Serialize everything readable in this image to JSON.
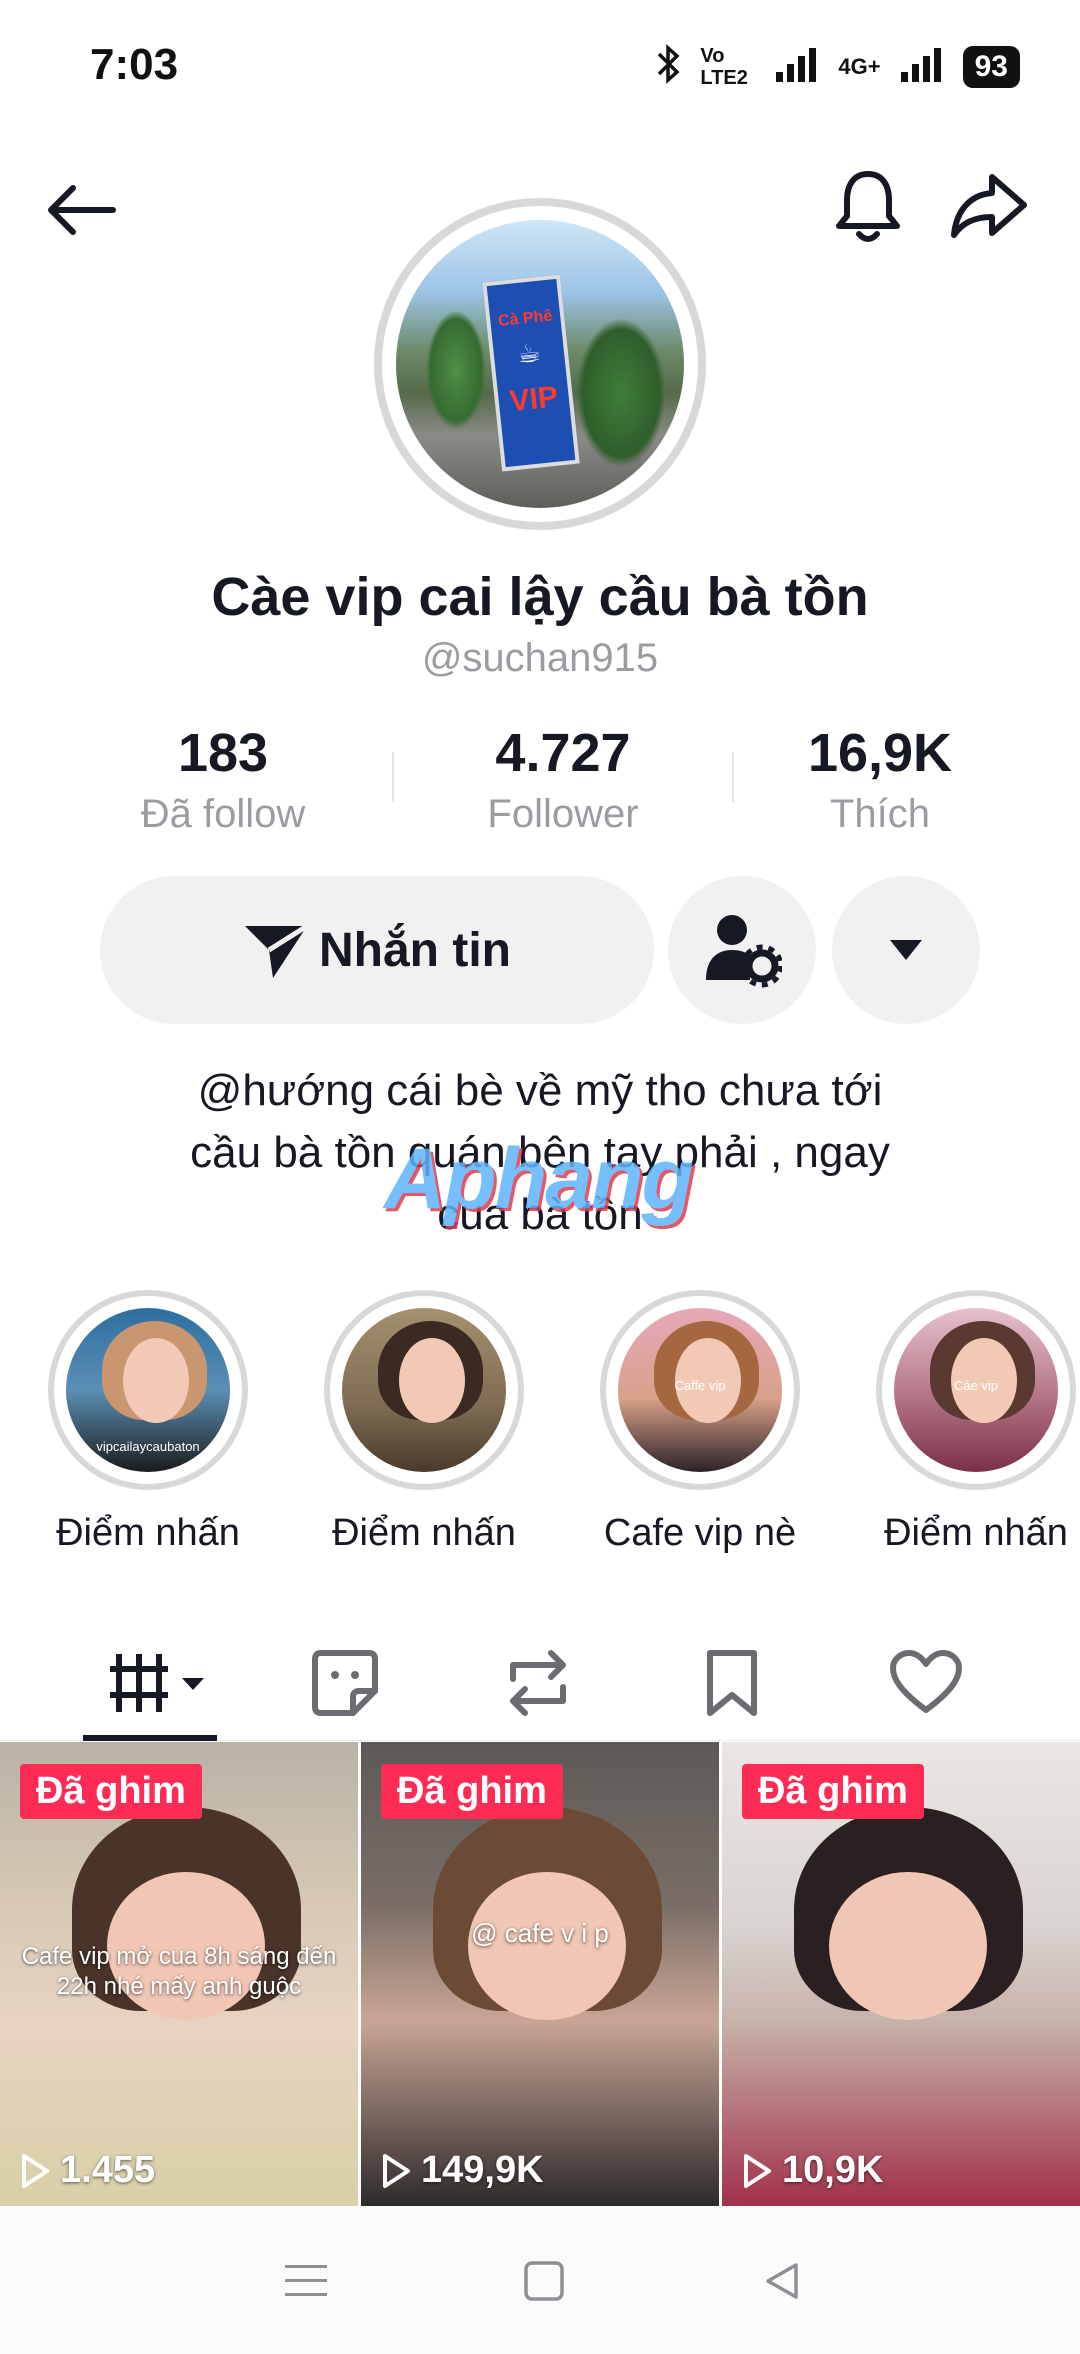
{
  "status_bar": {
    "time": "7:03",
    "network_1": "Vo LTE2",
    "network_2": "4G+",
    "battery": "93"
  },
  "profile": {
    "display_name": "Càe vip cai lậy cầu bà tồn",
    "username": "@suchan915",
    "stats": [
      {
        "value": "183",
        "label": "Đã follow"
      },
      {
        "value": "4.727",
        "label": "Follower"
      },
      {
        "value": "16,9K",
        "label": "Thích"
      }
    ],
    "message_button": "Nhắn tin",
    "bio_lines": [
      "@hướng cái bè về mỹ tho chưa tới",
      "cầu bà tồn quán bên tay phải , ngay",
      "cua bà tồn"
    ],
    "watermark": "Aphang",
    "avatar_sign": {
      "line1": "Cà Phê",
      "line2": "VIP"
    }
  },
  "highlights": [
    {
      "label": "Điểm nhấn",
      "overlay": "vipcailaycaubaton"
    },
    {
      "label": "Điểm nhấn",
      "overlay": ""
    },
    {
      "label": "Cafe vip nè",
      "overlay": "Caffe vip"
    },
    {
      "label": "Điểm nhấn",
      "overlay": "Càe vip"
    }
  ],
  "tabs": [
    {
      "icon": "grid-icon",
      "active": true
    },
    {
      "icon": "sticker-icon",
      "active": false
    },
    {
      "icon": "repost-icon",
      "active": false
    },
    {
      "icon": "bookmark-icon",
      "active": false
    },
    {
      "icon": "heart-icon",
      "active": false
    }
  ],
  "videos": [
    {
      "badge": "Đã ghim",
      "caption": "Cafe vip mở cua 8h sáng đến 22h nhé mấy anh guộc",
      "views": "1.455"
    },
    {
      "badge": "Đã ghim",
      "caption": "@ cafe v i p",
      "views": "149,9K"
    },
    {
      "badge": "Đã ghim",
      "caption": "",
      "views": "10,9K"
    }
  ],
  "colors": {
    "accent": "#fe2c55",
    "text": "#161823",
    "muted": "#9b9ca2",
    "button_bg": "#f1f1f2"
  }
}
